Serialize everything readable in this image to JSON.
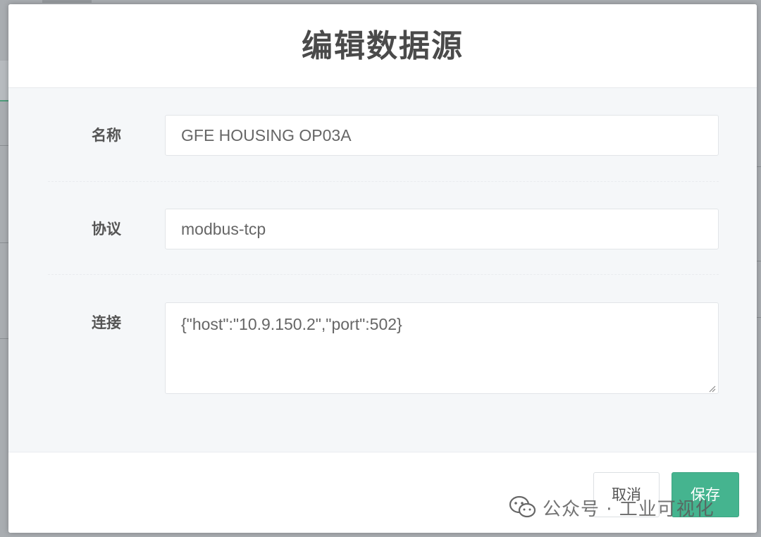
{
  "modal": {
    "title": "编辑数据源"
  },
  "form": {
    "name": {
      "label": "名称",
      "value": "GFE HOUSING OP03A"
    },
    "protocol": {
      "label": "协议",
      "value": "modbus-tcp"
    },
    "connection": {
      "label": "连接",
      "value": "{\"host\":\"10.9.150.2\",\"port\":502}"
    }
  },
  "footer": {
    "cancel_label": "取消",
    "save_label": "保存"
  },
  "watermark": {
    "text": "公众号 · 工业可视化",
    "icon": "wechat-icon"
  },
  "colors": {
    "accent": "#45b48f",
    "title": "#4a4a4a",
    "body_bg": "#f5f7f9"
  }
}
